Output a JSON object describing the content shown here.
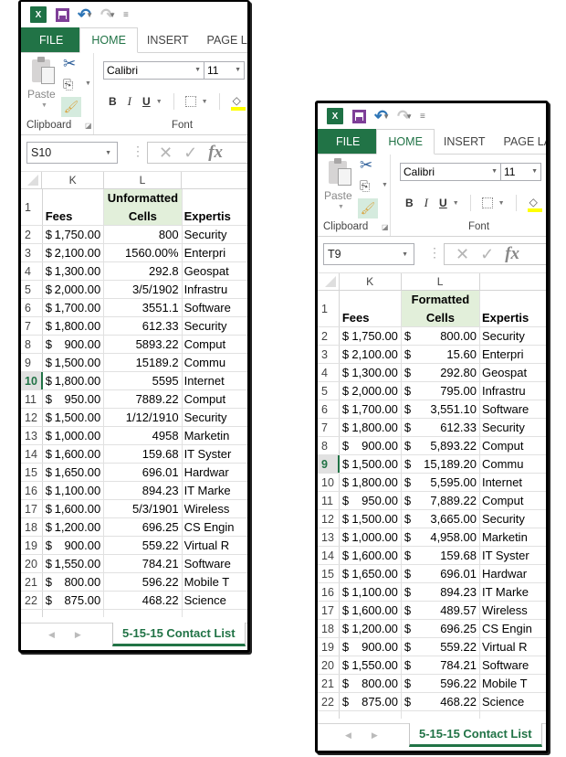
{
  "panels": [
    {
      "qat": {
        "undo_icon": "undo-icon",
        "redo_icon": "redo-icon",
        "customize_icon": "customize-qat-icon"
      },
      "tabs": [
        "FILE",
        "HOME",
        "INSERT",
        "PAGE LA"
      ],
      "ribbon": {
        "paste_label": "Paste",
        "clipboard_label": "Clipboard",
        "font_label": "Font",
        "font_name": "Calibri",
        "font_size": "11",
        "bold": "B",
        "italic": "I",
        "underline": "U",
        "fill_color": "#ffff00"
      },
      "name_box": "S10",
      "formula_bar": {
        "cancel": "✕",
        "enter": "✓",
        "fx": "fx"
      },
      "columns": [
        "K",
        "L",
        ""
      ],
      "header_row": {
        "num": "1",
        "k": "Fees",
        "l_line1": "Unformatted",
        "l_line2": "Cells",
        "m": "Expertis"
      },
      "selected_row": "10",
      "rows": [
        {
          "num": "2",
          "k_sym": "$",
          "k_val": "1,750.00",
          "l": "800",
          "m": "Security"
        },
        {
          "num": "3",
          "k_sym": "$",
          "k_val": "2,100.00",
          "l": "1560.00%",
          "m": "Enterpri"
        },
        {
          "num": "4",
          "k_sym": "$",
          "k_val": "1,300.00",
          "l": "292.8",
          "m": "Geospat"
        },
        {
          "num": "5",
          "k_sym": "$",
          "k_val": "2,000.00",
          "l": "3/5/1902",
          "m": "Infrastru"
        },
        {
          "num": "6",
          "k_sym": "$",
          "k_val": "1,700.00",
          "l": "3551.1",
          "m": "Software"
        },
        {
          "num": "7",
          "k_sym": "$",
          "k_val": "1,800.00",
          "l": "612.33",
          "m": "Security"
        },
        {
          "num": "8",
          "k_sym": "$",
          "k_val": "900.00",
          "l": "5893.22",
          "m": "Comput"
        },
        {
          "num": "9",
          "k_sym": "$",
          "k_val": "1,500.00",
          "l": "15189.2",
          "m": "Commu"
        },
        {
          "num": "10",
          "k_sym": "$",
          "k_val": "1,800.00",
          "l": "5595",
          "m": "Internet"
        },
        {
          "num": "11",
          "k_sym": "$",
          "k_val": "950.00",
          "l": "7889.22",
          "m": "Comput"
        },
        {
          "num": "12",
          "k_sym": "$",
          "k_val": "1,500.00",
          "l": "1/12/1910",
          "m": "Security"
        },
        {
          "num": "13",
          "k_sym": "$",
          "k_val": "1,000.00",
          "l": "4958",
          "m": "Marketin"
        },
        {
          "num": "14",
          "k_sym": "$",
          "k_val": "1,600.00",
          "l": "159.68",
          "m": "IT Syster"
        },
        {
          "num": "15",
          "k_sym": "$",
          "k_val": "1,650.00",
          "l": "696.01",
          "m": "Hardwar"
        },
        {
          "num": "16",
          "k_sym": "$",
          "k_val": "1,100.00",
          "l": "894.23",
          "m": "IT Marke"
        },
        {
          "num": "17",
          "k_sym": "$",
          "k_val": "1,600.00",
          "l": "5/3/1901",
          "m": "Wireless"
        },
        {
          "num": "18",
          "k_sym": "$",
          "k_val": "1,200.00",
          "l": "696.25",
          "m": "CS Engin"
        },
        {
          "num": "19",
          "k_sym": "$",
          "k_val": "900.00",
          "l": "559.22",
          "m": "Virtual R"
        },
        {
          "num": "20",
          "k_sym": "$",
          "k_val": "1,550.00",
          "l": "784.21",
          "m": "Software"
        },
        {
          "num": "21",
          "k_sym": "$",
          "k_val": "800.00",
          "l": "596.22",
          "m": "Mobile T"
        },
        {
          "num": "22",
          "k_sym": "$",
          "k_val": "875.00",
          "l": "468.22",
          "m": "Science"
        }
      ],
      "sheet_tab": "5-15-15 Contact List"
    },
    {
      "qat": {
        "undo_icon": "undo-icon",
        "redo_icon": "redo-icon",
        "customize_icon": "customize-qat-icon"
      },
      "tabs": [
        "FILE",
        "HOME",
        "INSERT",
        "PAGE LA"
      ],
      "ribbon": {
        "paste_label": "Paste",
        "clipboard_label": "Clipboard",
        "font_label": "Font",
        "font_name": "Calibri",
        "font_size": "11",
        "bold": "B",
        "italic": "I",
        "underline": "U",
        "fill_color": "#ffff00"
      },
      "name_box": "T9",
      "formula_bar": {
        "cancel": "✕",
        "enter": "✓",
        "fx": "fx"
      },
      "columns": [
        "K",
        "L",
        ""
      ],
      "header_row": {
        "num": "1",
        "k": "Fees",
        "l_line1": "Formatted",
        "l_line2": "Cells",
        "m": "Expertis"
      },
      "selected_row": "9",
      "rows": [
        {
          "num": "2",
          "k_sym": "$",
          "k_val": "1,750.00",
          "l_sym": "$",
          "l": "800.00",
          "m": "Security"
        },
        {
          "num": "3",
          "k_sym": "$",
          "k_val": "2,100.00",
          "l_sym": "$",
          "l": "15.60",
          "m": "Enterpri"
        },
        {
          "num": "4",
          "k_sym": "$",
          "k_val": "1,300.00",
          "l_sym": "$",
          "l": "292.80",
          "m": "Geospat"
        },
        {
          "num": "5",
          "k_sym": "$",
          "k_val": "2,000.00",
          "l_sym": "$",
          "l": "795.00",
          "m": "Infrastru"
        },
        {
          "num": "6",
          "k_sym": "$",
          "k_val": "1,700.00",
          "l_sym": "$",
          "l": "3,551.10",
          "m": "Software"
        },
        {
          "num": "7",
          "k_sym": "$",
          "k_val": "1,800.00",
          "l_sym": "$",
          "l": "612.33",
          "m": "Security"
        },
        {
          "num": "8",
          "k_sym": "$",
          "k_val": "900.00",
          "l_sym": "$",
          "l": "5,893.22",
          "m": "Comput"
        },
        {
          "num": "9",
          "k_sym": "$",
          "k_val": "1,500.00",
          "l_sym": "$",
          "l": "15,189.20",
          "m": "Commu"
        },
        {
          "num": "10",
          "k_sym": "$",
          "k_val": "1,800.00",
          "l_sym": "$",
          "l": "5,595.00",
          "m": "Internet"
        },
        {
          "num": "11",
          "k_sym": "$",
          "k_val": "950.00",
          "l_sym": "$",
          "l": "7,889.22",
          "m": "Comput"
        },
        {
          "num": "12",
          "k_sym": "$",
          "k_val": "1,500.00",
          "l_sym": "$",
          "l": "3,665.00",
          "m": "Security"
        },
        {
          "num": "13",
          "k_sym": "$",
          "k_val": "1,000.00",
          "l_sym": "$",
          "l": "4,958.00",
          "m": "Marketin"
        },
        {
          "num": "14",
          "k_sym": "$",
          "k_val": "1,600.00",
          "l_sym": "$",
          "l": "159.68",
          "m": "IT Syster"
        },
        {
          "num": "15",
          "k_sym": "$",
          "k_val": "1,650.00",
          "l_sym": "$",
          "l": "696.01",
          "m": "Hardwar"
        },
        {
          "num": "16",
          "k_sym": "$",
          "k_val": "1,100.00",
          "l_sym": "$",
          "l": "894.23",
          "m": "IT Marke"
        },
        {
          "num": "17",
          "k_sym": "$",
          "k_val": "1,600.00",
          "l_sym": "$",
          "l": "489.57",
          "m": "Wireless"
        },
        {
          "num": "18",
          "k_sym": "$",
          "k_val": "1,200.00",
          "l_sym": "$",
          "l": "696.25",
          "m": "CS Engin"
        },
        {
          "num": "19",
          "k_sym": "$",
          "k_val": "900.00",
          "l_sym": "$",
          "l": "559.22",
          "m": "Virtual R"
        },
        {
          "num": "20",
          "k_sym": "$",
          "k_val": "1,550.00",
          "l_sym": "$",
          "l": "784.21",
          "m": "Software"
        },
        {
          "num": "21",
          "k_sym": "$",
          "k_val": "800.00",
          "l_sym": "$",
          "l": "596.22",
          "m": "Mobile T"
        },
        {
          "num": "22",
          "k_sym": "$",
          "k_val": "875.00",
          "l_sym": "$",
          "l": "468.22",
          "m": "Science"
        }
      ],
      "sheet_tab": "5-15-15 Contact List"
    }
  ]
}
